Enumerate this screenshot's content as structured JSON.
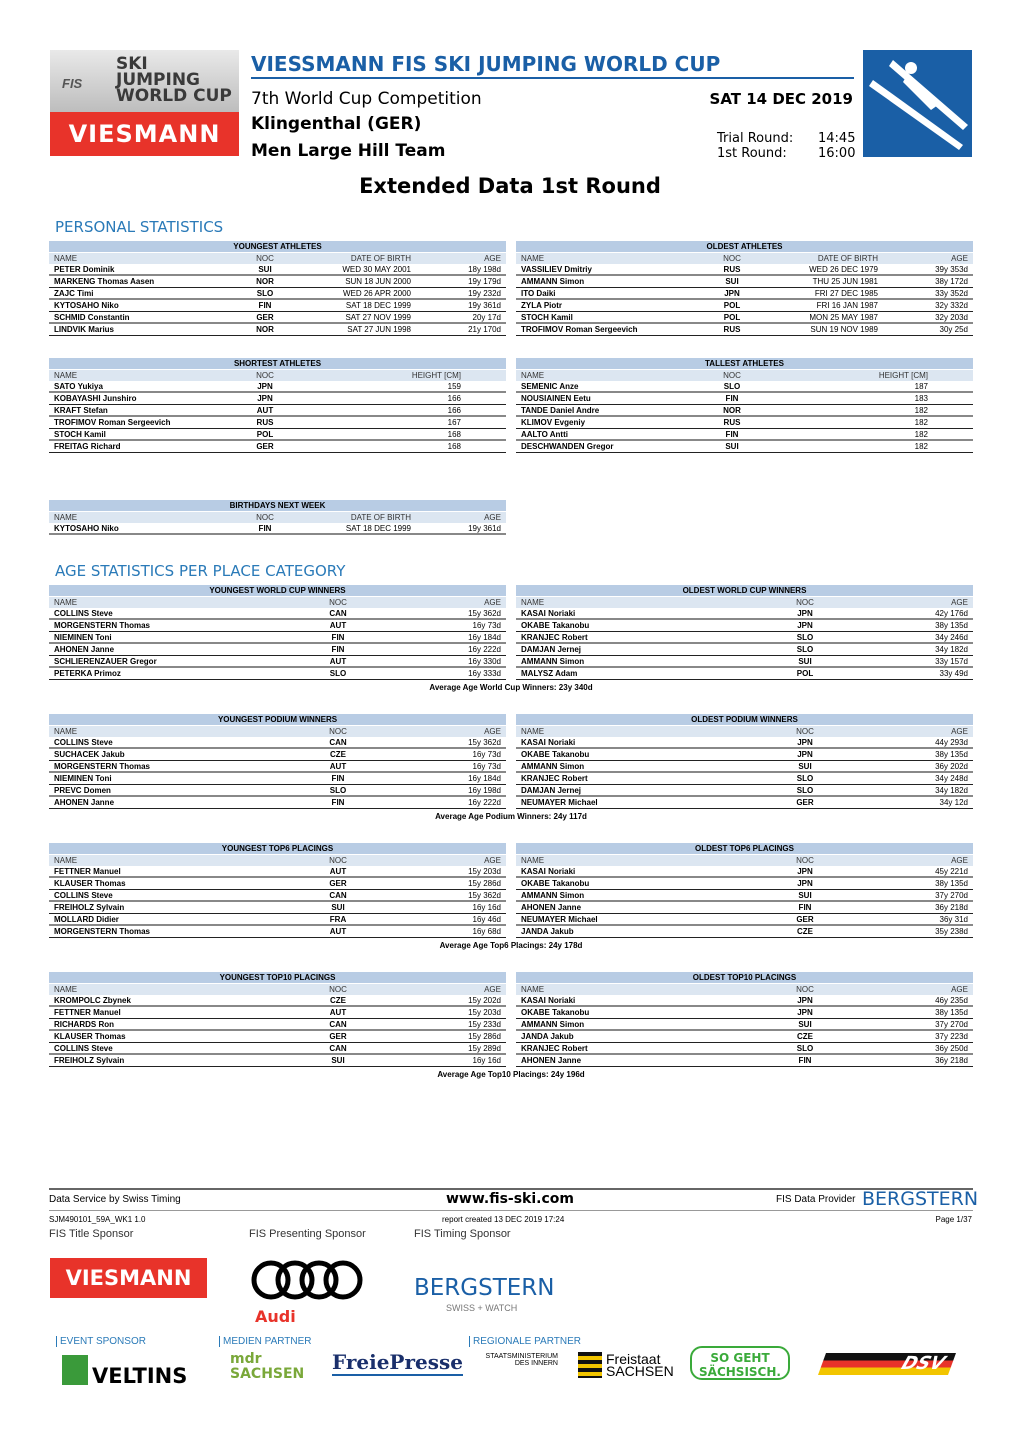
{
  "header": {
    "logo_top": "SKI JUMPING WORLD CUP",
    "logo_fis": "FIS",
    "logo_sponsor": "VIESMANN",
    "title": "VIESSMANN FIS SKI JUMPING WORLD CUP",
    "competition": "7th World Cup Competition",
    "venue": "Klingenthal (GER)",
    "event": "Men Large Hill Team",
    "date": "SAT 14 DEC 2019",
    "trial_label": "Trial Round:",
    "trial_time": "14:45",
    "first_label": "1st Round:",
    "first_time": "16:00",
    "report_title": "Extended Data 1st Round",
    "accent": "#1a5fa6"
  },
  "personal": {
    "title": "PERSONAL STATISTICS",
    "youngest": {
      "title": "YOUNGEST ATHLETES",
      "cols": [
        "NAME",
        "NOC",
        "DATE OF BIRTH",
        "AGE"
      ],
      "rows": [
        [
          "PETER Dominik",
          "SUI",
          "WED 30 MAY 2001",
          "18y 198d"
        ],
        [
          "MARKENG Thomas Aasen",
          "NOR",
          "SUN 18 JUN 2000",
          "19y 179d"
        ],
        [
          "ZAJC Timi",
          "SLO",
          "WED 26 APR 2000",
          "19y 232d"
        ],
        [
          "KYTOSAHO Niko",
          "FIN",
          "SAT 18 DEC 1999",
          "19y 361d"
        ],
        [
          "SCHMID Constantin",
          "GER",
          "SAT 27 NOV 1999",
          "20y 17d"
        ],
        [
          "LINDVIK Marius",
          "NOR",
          "SAT 27 JUN 1998",
          "21y 170d"
        ]
      ]
    },
    "oldest": {
      "title": "OLDEST ATHLETES",
      "cols": [
        "NAME",
        "NOC",
        "DATE OF BIRTH",
        "AGE"
      ],
      "rows": [
        [
          "VASSILIEV Dmitriy",
          "RUS",
          "WED 26 DEC 1979",
          "39y 353d"
        ],
        [
          "AMMANN Simon",
          "SUI",
          "THU 25 JUN 1981",
          "38y 172d"
        ],
        [
          "ITO Daiki",
          "JPN",
          "FRI 27 DEC 1985",
          "33y 352d"
        ],
        [
          "ZYLA Piotr",
          "POL",
          "FRI 16 JAN 1987",
          "32y 332d"
        ],
        [
          "STOCH Kamil",
          "POL",
          "MON 25 MAY 1987",
          "32y 203d"
        ],
        [
          "TROFIMOV Roman Sergeevich",
          "RUS",
          "SUN 19 NOV 1989",
          "30y 25d"
        ]
      ]
    },
    "shortest": {
      "title": "SHORTEST ATHLETES",
      "cols": [
        "NAME",
        "NOC",
        "HEIGHT [CM]"
      ],
      "rows": [
        [
          "SATO Yukiya",
          "JPN",
          "159"
        ],
        [
          "KOBAYASHI Junshiro",
          "JPN",
          "166"
        ],
        [
          "KRAFT Stefan",
          "AUT",
          "166"
        ],
        [
          "TROFIMOV Roman Sergeevich",
          "RUS",
          "167"
        ],
        [
          "STOCH Kamil",
          "POL",
          "168"
        ],
        [
          "FREITAG Richard",
          "GER",
          "168"
        ]
      ]
    },
    "tallest": {
      "title": "TALLEST ATHLETES",
      "cols": [
        "NAME",
        "NOC",
        "HEIGHT [CM]"
      ],
      "rows": [
        [
          "SEMENIC Anze",
          "SLO",
          "187"
        ],
        [
          "NOUSIAINEN Eetu",
          "FIN",
          "183"
        ],
        [
          "TANDE Daniel Andre",
          "NOR",
          "182"
        ],
        [
          "KLIMOV Evgeniy",
          "RUS",
          "182"
        ],
        [
          "AALTO Antti",
          "FIN",
          "182"
        ],
        [
          "DESCHWANDEN Gregor",
          "SUI",
          "182"
        ]
      ]
    },
    "birthdays": {
      "title": "BIRTHDAYS NEXT WEEK",
      "cols": [
        "NAME",
        "NOC",
        "DATE OF BIRTH",
        "AGE"
      ],
      "rows": [
        [
          "KYTOSAHO Niko",
          "FIN",
          "SAT 18 DEC 1999",
          "19y 361d"
        ]
      ]
    }
  },
  "age": {
    "title": "AGE STATISTICS PER PLACE CATEGORY",
    "groups": [
      {
        "young": {
          "title": "YOUNGEST WORLD CUP WINNERS",
          "cols": [
            "NAME",
            "NOC",
            "AGE"
          ],
          "rows": [
            [
              "COLLINS Steve",
              "CAN",
              "15y 362d"
            ],
            [
              "MORGENSTERN Thomas",
              "AUT",
              "16y 73d"
            ],
            [
              "NIEMINEN Toni",
              "FIN",
              "16y 184d"
            ],
            [
              "AHONEN Janne",
              "FIN",
              "16y 222d"
            ],
            [
              "SCHLIERENZAUER Gregor",
              "AUT",
              "16y 330d"
            ],
            [
              "PETERKA Primoz",
              "SLO",
              "16y 333d"
            ]
          ]
        },
        "old": {
          "title": "OLDEST WORLD CUP WINNERS",
          "cols": [
            "NAME",
            "NOC",
            "AGE"
          ],
          "rows": [
            [
              "KASAI Noriaki",
              "JPN",
              "42y 176d"
            ],
            [
              "OKABE Takanobu",
              "JPN",
              "38y 135d"
            ],
            [
              "KRANJEC Robert",
              "SLO",
              "34y 246d"
            ],
            [
              "DAMJAN Jernej",
              "SLO",
              "34y 182d"
            ],
            [
              "AMMANN Simon",
              "SUI",
              "33y 157d"
            ],
            [
              "MALYSZ Adam",
              "POL",
              "33y 49d"
            ]
          ]
        },
        "avg": "Average Age World Cup Winners:  23y 340d"
      },
      {
        "young": {
          "title": "YOUNGEST PODIUM WINNERS",
          "cols": [
            "NAME",
            "NOC",
            "AGE"
          ],
          "rows": [
            [
              "COLLINS Steve",
              "CAN",
              "15y 362d"
            ],
            [
              "SUCHACEK Jakub",
              "CZE",
              "16y 73d"
            ],
            [
              "MORGENSTERN Thomas",
              "AUT",
              "16y 73d"
            ],
            [
              "NIEMINEN Toni",
              "FIN",
              "16y 184d"
            ],
            [
              "PREVC Domen",
              "SLO",
              "16y 198d"
            ],
            [
              "AHONEN Janne",
              "FIN",
              "16y 222d"
            ]
          ]
        },
        "old": {
          "title": "OLDEST PODIUM WINNERS",
          "cols": [
            "NAME",
            "NOC",
            "AGE"
          ],
          "rows": [
            [
              "KASAI Noriaki",
              "JPN",
              "44y 293d"
            ],
            [
              "OKABE Takanobu",
              "JPN",
              "38y 135d"
            ],
            [
              "AMMANN Simon",
              "SUI",
              "36y 202d"
            ],
            [
              "KRANJEC Robert",
              "SLO",
              "34y 248d"
            ],
            [
              "DAMJAN Jernej",
              "SLO",
              "34y 182d"
            ],
            [
              "NEUMAYER Michael",
              "GER",
              "34y 12d"
            ]
          ]
        },
        "avg": "Average Age Podium Winners:  24y 117d"
      },
      {
        "young": {
          "title": "YOUNGEST TOP6 PLACINGS",
          "cols": [
            "NAME",
            "NOC",
            "AGE"
          ],
          "rows": [
            [
              "FETTNER Manuel",
              "AUT",
              "15y 203d"
            ],
            [
              "KLAUSER Thomas",
              "GER",
              "15y 286d"
            ],
            [
              "COLLINS Steve",
              "CAN",
              "15y 362d"
            ],
            [
              "FREIHOLZ Sylvain",
              "SUI",
              "16y 16d"
            ],
            [
              "MOLLARD Didier",
              "FRA",
              "16y 46d"
            ],
            [
              "MORGENSTERN Thomas",
              "AUT",
              "16y 68d"
            ]
          ]
        },
        "old": {
          "title": "OLDEST TOP6 PLACINGS",
          "cols": [
            "NAME",
            "NOC",
            "AGE"
          ],
          "rows": [
            [
              "KASAI Noriaki",
              "JPN",
              "45y 221d"
            ],
            [
              "OKABE Takanobu",
              "JPN",
              "38y 135d"
            ],
            [
              "AMMANN Simon",
              "SUI",
              "37y 270d"
            ],
            [
              "AHONEN Janne",
              "FIN",
              "36y 218d"
            ],
            [
              "NEUMAYER Michael",
              "GER",
              "36y 31d"
            ],
            [
              "JANDA Jakub",
              "CZE",
              "35y 238d"
            ]
          ]
        },
        "avg": "Average Age Top6 Placings:  24y 178d"
      },
      {
        "young": {
          "title": "YOUNGEST TOP10 PLACINGS",
          "cols": [
            "NAME",
            "NOC",
            "AGE"
          ],
          "rows": [
            [
              "KROMPOLC Zbynek",
              "CZE",
              "15y 202d"
            ],
            [
              "FETTNER Manuel",
              "AUT",
              "15y 203d"
            ],
            [
              "RICHARDS Ron",
              "CAN",
              "15y 233d"
            ],
            [
              "KLAUSER Thomas",
              "GER",
              "15y 286d"
            ],
            [
              "COLLINS Steve",
              "CAN",
              "15y 289d"
            ],
            [
              "FREIHOLZ Sylvain",
              "SUI",
              "16y 16d"
            ]
          ]
        },
        "old": {
          "title": "OLDEST TOP10 PLACINGS",
          "cols": [
            "NAME",
            "NOC",
            "AGE"
          ],
          "rows": [
            [
              "KASAI Noriaki",
              "JPN",
              "46y 235d"
            ],
            [
              "OKABE Takanobu",
              "JPN",
              "38y 135d"
            ],
            [
              "AMMANN Simon",
              "SUI",
              "37y 270d"
            ],
            [
              "JANDA Jakub",
              "CZE",
              "37y 223d"
            ],
            [
              "KRANJEC Robert",
              "SLO",
              "36y 250d"
            ],
            [
              "AHONEN Janne",
              "FIN",
              "36y 218d"
            ]
          ]
        },
        "avg": "Average Age Top10 Placings:  24y 196d"
      }
    ]
  },
  "footer": {
    "data_service": "Data Service by Swiss Timing",
    "website": "www.fis-ski.com",
    "provider_label": "FIS Data Provider",
    "provider": "BERGSTERN",
    "code": "SJM490101_59A_WK1 1.0",
    "created": "report created  13 DEC 2019 17:24",
    "page": "Page 1/37",
    "title_sponsor": "FIS Title Sponsor",
    "presenting_sponsor": "FIS Presenting Sponsor",
    "timing_sponsor": "FIS Timing Sponsor",
    "event_sponsor": "EVENT SPONSOR",
    "media_partner": "MEDIEN PARTNER",
    "regional_partner": "REGIONALE PARTNER",
    "logos": {
      "viessmann": "VIESMANN",
      "audi": "Audi",
      "bergstern": "BERGSTERN",
      "bergstern_sub": "SWISS + WATCH",
      "veltins": "VELTINS",
      "mdr": "mdr SACHSEN",
      "freiepresse": "FreiePresse",
      "stmi": "STAATSMINISTERIUM DES INNERN",
      "sachsen": "Freistaat SACHSEN",
      "sogeht": "SO GEHT SÄCHSISCH.",
      "dsv": "DSV"
    }
  }
}
